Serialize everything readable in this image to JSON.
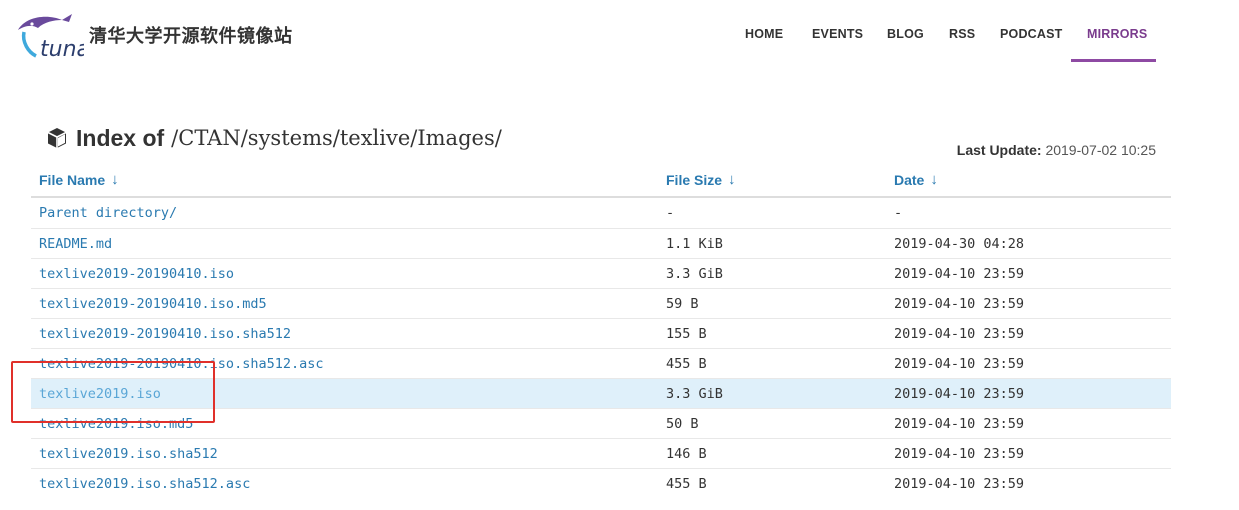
{
  "header": {
    "logo_text": "tuna",
    "site_title": "清华大学开源软件镜像站",
    "nav": [
      {
        "label": "HOME",
        "active": false
      },
      {
        "label": "EVENTS",
        "active": false
      },
      {
        "label": "BLOG",
        "active": false
      },
      {
        "label": "RSS",
        "active": false
      },
      {
        "label": "PODCAST",
        "active": false
      },
      {
        "label": "MIRRORS",
        "active": true
      }
    ],
    "accent_color": "#8e4aa3"
  },
  "index": {
    "prefix": "Index of",
    "path": "/CTAN/systems/texlive/Images/",
    "last_update_label": "Last Update:",
    "last_update_value": "2019-07-02 10:25"
  },
  "table": {
    "columns": [
      {
        "label": "File Name",
        "sort_icon": "↓"
      },
      {
        "label": "File Size",
        "sort_icon": "↓"
      },
      {
        "label": "Date",
        "sort_icon": "↓"
      }
    ],
    "rows": [
      {
        "name": "Parent directory/",
        "size": "-",
        "date": "-"
      },
      {
        "name": "README.md",
        "size": "1.1 KiB",
        "date": "2019-04-30 04:28"
      },
      {
        "name": "texlive2019-20190410.iso",
        "size": "3.3 GiB",
        "date": "2019-04-10 23:59"
      },
      {
        "name": "texlive2019-20190410.iso.md5",
        "size": "59 B",
        "date": "2019-04-10 23:59"
      },
      {
        "name": "texlive2019-20190410.iso.sha512",
        "size": "155 B",
        "date": "2019-04-10 23:59"
      },
      {
        "name": "texlive2019-20190410.iso.sha512.asc",
        "size": "455 B",
        "date": "2019-04-10 23:59"
      },
      {
        "name": "texlive2019.iso",
        "size": "3.3 GiB",
        "date": "2019-04-10 23:59",
        "highlighted": true
      },
      {
        "name": "texlive2019.iso.md5",
        "size": "50 B",
        "date": "2019-04-10 23:59"
      },
      {
        "name": "texlive2019.iso.sha512",
        "size": "146 B",
        "date": "2019-04-10 23:59"
      },
      {
        "name": "texlive2019.iso.sha512.asc",
        "size": "455 B",
        "date": "2019-04-10 23:59"
      }
    ],
    "link_color": "#2a7ab0",
    "highlight_color": "#dff0fa"
  },
  "annotation": {
    "color": "#e0302a",
    "target": "texlive2019.iso"
  }
}
